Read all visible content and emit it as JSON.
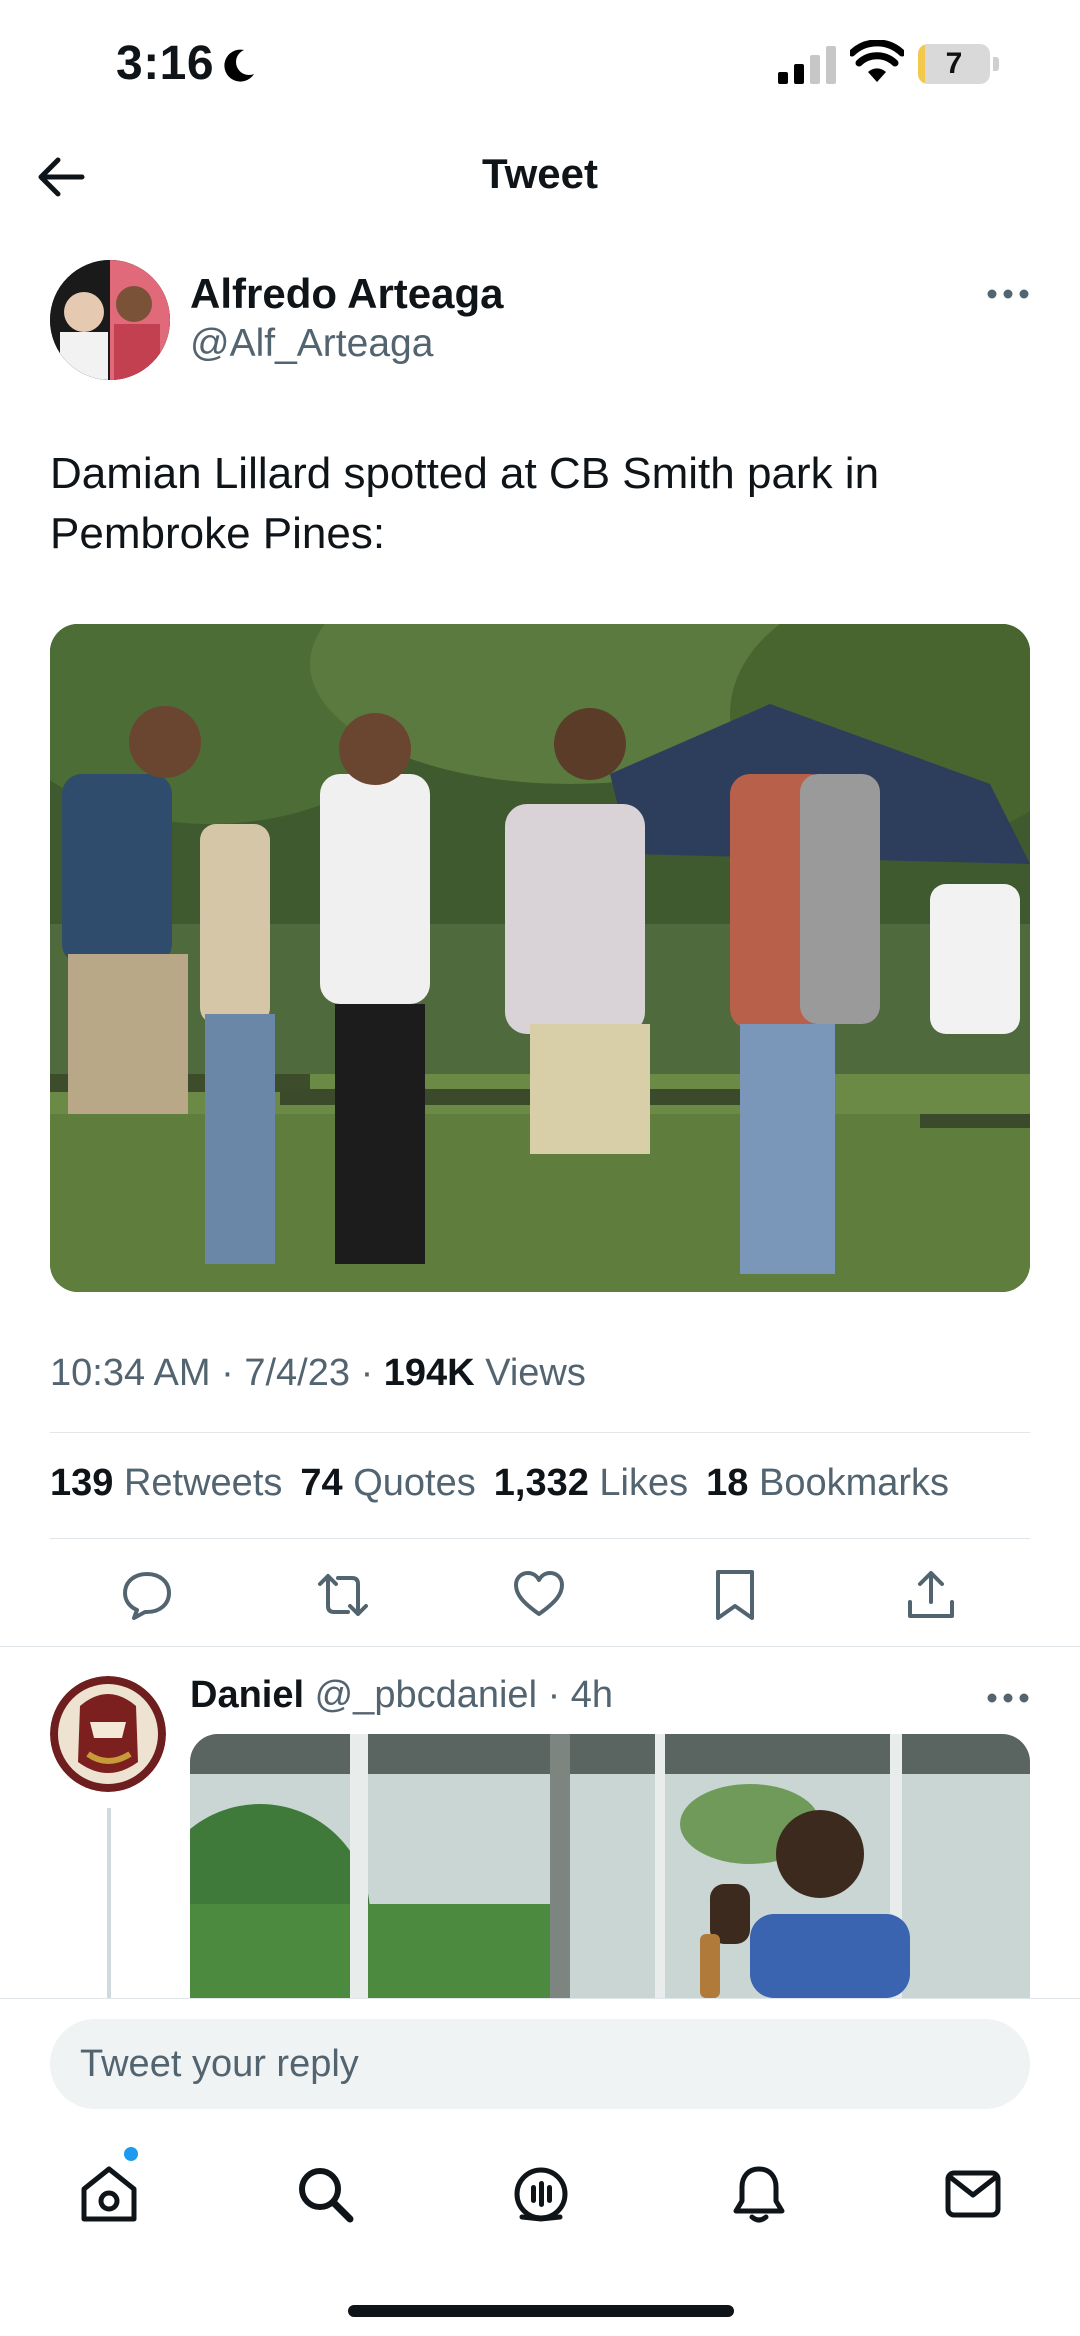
{
  "status": {
    "time": "3:16",
    "battery": "7",
    "battery_level_percent": 7
  },
  "header": {
    "title": "Tweet"
  },
  "tweet": {
    "author_name": "Alfredo Arteaga",
    "author_handle": "@Alf_Arteaga",
    "text": "Damian Lillard spotted at CB Smith park in Pembroke Pines:",
    "time": "10:34 AM",
    "date": "7/4/23",
    "views_count": "194K",
    "views_label": "Views",
    "stats": {
      "retweets": "139",
      "retweets_label": "Retweets",
      "quotes": "74",
      "quotes_label": "Quotes",
      "likes": "1,332",
      "likes_label": "Likes",
      "bookmarks": "18",
      "bookmarks_label": "Bookmarks"
    }
  },
  "reply": {
    "name": "Daniel",
    "handle": "@_pbcdaniel",
    "age": "4h"
  },
  "composer": {
    "placeholder": "Tweet your reply"
  },
  "icons": {
    "back": "arrow-left-icon",
    "more": "more-horizontal-icon",
    "actions": [
      "reply-icon",
      "retweet-icon",
      "like-icon",
      "bookmark-icon",
      "share-icon"
    ],
    "nav": [
      "home-icon",
      "search-icon",
      "spaces-icon",
      "notifications-icon",
      "messages-icon"
    ]
  },
  "colors": {
    "accent": "#1d9bf0",
    "secondary_text": "#536471",
    "battery_fill": "#f2c94c"
  }
}
